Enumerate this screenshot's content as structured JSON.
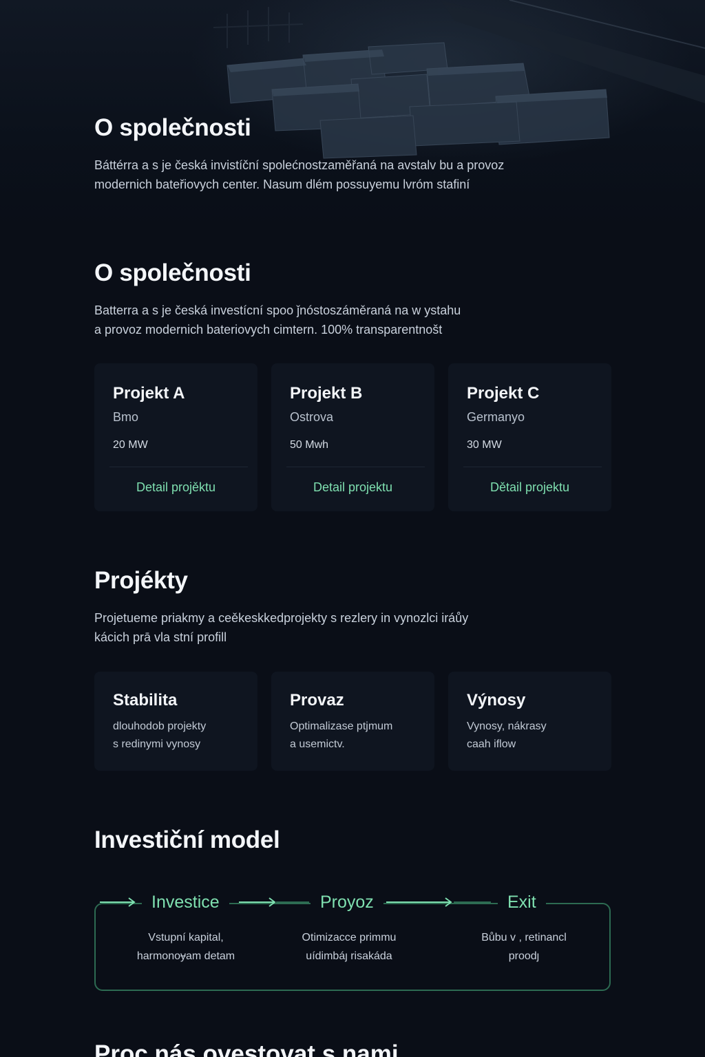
{
  "hero": {
    "title": "O společnosti",
    "text_line1": "Báttérra a s je česká invistíční spolećnostzaměřaná na avstalv bu a provoz",
    "text_line2": "modernich bateřiovych center. Nasum dlém possuyemu lvróm stafiní"
  },
  "about": {
    "title": "O společnosti",
    "text_line1": "Batterra a s je česká investícní spoo ǰnóstoszáměraná na w ystahu",
    "text_line2": "a provoz modernich bateriovych cimtern. 100% transparentnošt"
  },
  "projects_cards": [
    {
      "title": "Projekt A",
      "location": "Bmo",
      "capacity": "20 MW",
      "link": "Detail projěktu"
    },
    {
      "title": "Projekt B",
      "location": "Ostrova",
      "capacity": "50 Mwh",
      "link": "Detail projektu"
    },
    {
      "title": "Projekt C",
      "location": "Germanyo",
      "capacity": "30 MW",
      "link": "Dětail projektu"
    }
  ],
  "projects": {
    "title": "Projékty",
    "text_line1": "Projetueme priakmy a ceěkeskkedprojekty s rezlery in vynozlci iráůy",
    "text_line2": "kácich prā vla stní profill"
  },
  "features": [
    {
      "title": "Stabilita",
      "desc_line1": "dlouhodob projekty",
      "desc_line2": "s redinymi vynosy"
    },
    {
      "title": "Provaz",
      "desc_line1": "Optimalizase ptjmum",
      "desc_line2": "a usemictv."
    },
    {
      "title": "Výnosy",
      "desc_line1": "Vynosy, nákrasy",
      "desc_line2": "caah iflow"
    }
  ],
  "model": {
    "title": "Investiční model",
    "steps": [
      {
        "label": "Investice",
        "desc_line1": "Vstupní kapital,",
        "desc_line2": "harmonoɏam detam"
      },
      {
        "label": "Proyoz",
        "desc_line1": "Otimizacce primmu",
        "desc_line2": "uídimbáȷ risakáda"
      },
      {
        "label": "Exit",
        "desc_line1": "Bůbu  v , retinancl",
        "desc_line2": "proodȷ"
      }
    ]
  },
  "footer": {
    "title": "Proc nás ovestovat s nami"
  },
  "colors": {
    "background": "#0a0e17",
    "card": "#0f1520",
    "accent": "#7fe0b0",
    "border": "#2d6b52"
  }
}
